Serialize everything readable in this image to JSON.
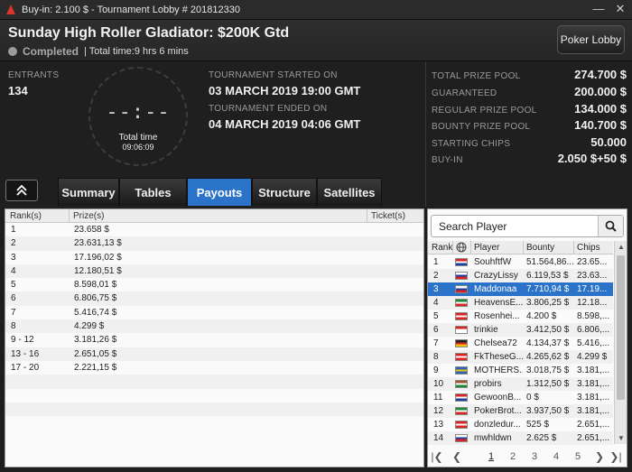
{
  "window": {
    "title": "Buy-in: 2.100 $ - Tournament Lobby # 201812330"
  },
  "header": {
    "tournament_name": "Sunday High Roller Gladiator: $200K Gtd",
    "status": "Completed",
    "total_time": "| Total time:9 hrs  6 mins",
    "lobby_button": "Poker Lobby"
  },
  "info": {
    "entrants_label": "ENTRANTS",
    "entrants_value": "134",
    "clock_digits": "--:--",
    "clock_label": "Total time",
    "clock_value": "09:06:09",
    "started_label": "TOURNAMENT STARTED ON",
    "started_value": "03 MARCH 2019  19:00 GMT",
    "ended_label": "TOURNAMENT ENDED ON",
    "ended_value": "04 MARCH 2019  04:06 GMT"
  },
  "prizes": [
    {
      "label": "TOTAL PRIZE POOL",
      "value": "274.700 $"
    },
    {
      "label": "GUARANTEED",
      "value": "200.000 $"
    },
    {
      "label": "REGULAR PRIZE POOL",
      "value": "134.000 $"
    },
    {
      "label": "BOUNTY PRIZE POOL",
      "value": "140.700 $"
    },
    {
      "label": "STARTING CHIPS",
      "value": "50.000"
    },
    {
      "label": "BUY-IN",
      "value": "2.050 $+50 $"
    }
  ],
  "tabs": [
    "Summary",
    "Tables",
    "Payouts",
    "Structure",
    "Satellites"
  ],
  "payouts": {
    "headers": [
      "Rank(s)",
      "Prize(s)",
      "Ticket(s)"
    ],
    "rows": [
      [
        "1",
        "23.658 $"
      ],
      [
        "2",
        "23.631,13 $"
      ],
      [
        "3",
        "17.196,02 $"
      ],
      [
        "4",
        "12.180,51 $"
      ],
      [
        "5",
        "8.598,01 $"
      ],
      [
        "6",
        "6.806,75 $"
      ],
      [
        "7",
        "5.416,74 $"
      ],
      [
        "8",
        "4.299 $"
      ],
      [
        "9 - 12",
        "3.181,26 $"
      ],
      [
        "13 - 16",
        "2.651,05 $"
      ],
      [
        "17 - 20",
        "2.221,15 $"
      ]
    ]
  },
  "players": {
    "search_placeholder": "Search Player",
    "headers": [
      "Rank",
      "Player",
      "Bounty",
      "Chips"
    ],
    "rows": [
      {
        "rank": "1",
        "name": "SouhftfW",
        "bounty": "51.564,86...",
        "chips": "23.65...",
        "flag": [
          "#d22",
          "#fff",
          "#1a3fa0"
        ]
      },
      {
        "rank": "2",
        "name": "CrazyLissy",
        "bounty": "6.119,53 $",
        "chips": "23.63...",
        "flag": [
          "#fff",
          "#1a3fa0",
          "#d22"
        ]
      },
      {
        "rank": "3",
        "name": "Maddonaa",
        "bounty": "7.710,94 $",
        "chips": "17.19...",
        "flag": [
          "#fff",
          "#1a3fa0",
          "#d22"
        ]
      },
      {
        "rank": "4",
        "name": "HeavensE...",
        "bounty": "3.806,25 $",
        "chips": "12.18...",
        "flag": [
          "#1b8a3a",
          "#fff",
          "#d22"
        ]
      },
      {
        "rank": "5",
        "name": "Rosenhei...",
        "bounty": "4.200 $",
        "chips": "8.598,...",
        "flag": [
          "#d22",
          "#fff",
          "#d22"
        ]
      },
      {
        "rank": "6",
        "name": "trinkie",
        "bounty": "3.412,50 $",
        "chips": "6.806,...",
        "flag": [
          "#d22",
          "#fff",
          "#fff"
        ]
      },
      {
        "rank": "7",
        "name": "Chelsea72",
        "bounty": "4.134,37 $",
        "chips": "5.416,...",
        "flag": [
          "#222",
          "#d22",
          "#f2c500"
        ]
      },
      {
        "rank": "8",
        "name": "FkTheseG...",
        "bounty": "4.265,62 $",
        "chips": "4.299 $",
        "flag": [
          "#d22",
          "#fff",
          "#d22"
        ]
      },
      {
        "rank": "9",
        "name": "MOTHERS...",
        "bounty": "3.018,75 $",
        "chips": "3.181,...",
        "flag": [
          "#2a63b8",
          "#f2c500",
          "#2a63b8"
        ]
      },
      {
        "rank": "10",
        "name": "probirs",
        "bounty": "1.312,50 $",
        "chips": "3.181,...",
        "flag": [
          "#a0522d",
          "#fff",
          "#1b8a3a"
        ]
      },
      {
        "rank": "11",
        "name": "GewoonB...",
        "bounty": "0 $",
        "chips": "3.181,...",
        "flag": [
          "#d22",
          "#fff",
          "#1a3fa0"
        ]
      },
      {
        "rank": "12",
        "name": "PokerBrot...",
        "bounty": "3.937,50 $",
        "chips": "3.181,...",
        "flag": [
          "#1b8a3a",
          "#fff",
          "#d22"
        ]
      },
      {
        "rank": "13",
        "name": "donzledur...",
        "bounty": "525 $",
        "chips": "2.651,...",
        "flag": [
          "#d22",
          "#fff",
          "#d22"
        ]
      },
      {
        "rank": "14",
        "name": "mwhldwn",
        "bounty": "2.625 $",
        "chips": "2.651,...",
        "flag": [
          "#fff",
          "#1a3fa0",
          "#d22"
        ]
      }
    ],
    "pager": [
      "1",
      "2",
      "3",
      "4",
      "5"
    ]
  },
  "colors": {
    "accent": "#2a73c9",
    "background": "#1e1e1e"
  },
  "icons": {
    "search": "search-icon",
    "collapse": "chevron-up-double-icon",
    "globe": "globe-icon"
  }
}
